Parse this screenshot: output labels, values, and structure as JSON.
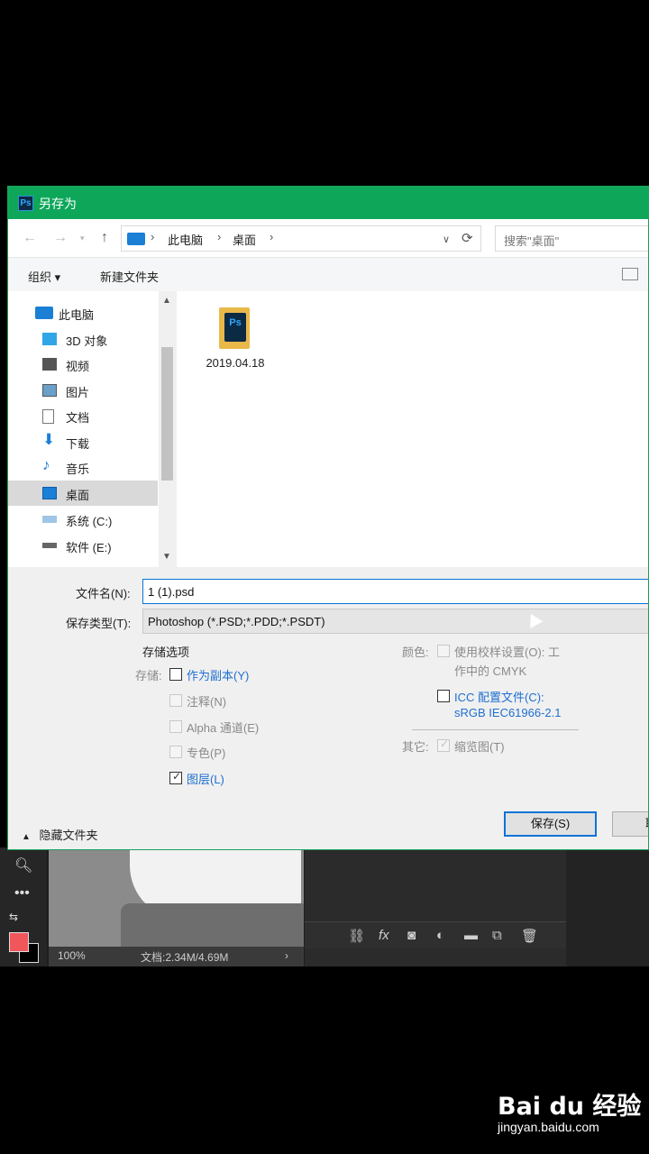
{
  "dialog": {
    "title": "另存为",
    "address": {
      "crumb1": "此电脑",
      "crumb2": "桌面"
    },
    "search_placeholder": "搜索\"桌面\"",
    "toolbar": {
      "organize": "组织 ▾",
      "new_folder": "新建文件夹"
    },
    "nav": {
      "this_pc": "此电脑",
      "items": [
        "3D 对象",
        "视频",
        "图片",
        "文档",
        "下载",
        "音乐",
        "桌面",
        "系统 (C:)",
        "软件 (E:)"
      ],
      "selected": "桌面"
    },
    "files": [
      {
        "name": "2019.04.18"
      }
    ],
    "filename_label": "文件名(N):",
    "filename_value": "1 (1).psd",
    "filetype_label": "保存类型(T):",
    "filetype_value": "Photoshop (*.PSD;*.PDD;*.PSDT)",
    "save_options": {
      "title": "存储选项",
      "save_label": "存储:",
      "as_copy": "作为副本(Y)",
      "notes": "注释(N)",
      "alpha": "Alpha 通道(E)",
      "spot": "专色(P)",
      "layers": "图层(L)"
    },
    "color": {
      "label": "颜色:",
      "proof_line1": "使用校样设置(O): 工",
      "proof_line2": "作中的 CMYK",
      "icc_line1": "ICC 配置文件(C):",
      "icc_line2": "sRGB IEC61966-2.1"
    },
    "other": {
      "label": "其它:",
      "thumbnail": "缩览图(T)"
    },
    "hide_folders": "隐藏文件夹",
    "save_button": "保存(S)",
    "cancel_button": "取"
  },
  "photoshop": {
    "zoom": "100%",
    "doc_info": "文档:2.34M/4.69M",
    "foreground_color": "#f0575a"
  },
  "watermark": {
    "logo": "Bai du 经验",
    "url": "jingyan.baidu.com"
  }
}
